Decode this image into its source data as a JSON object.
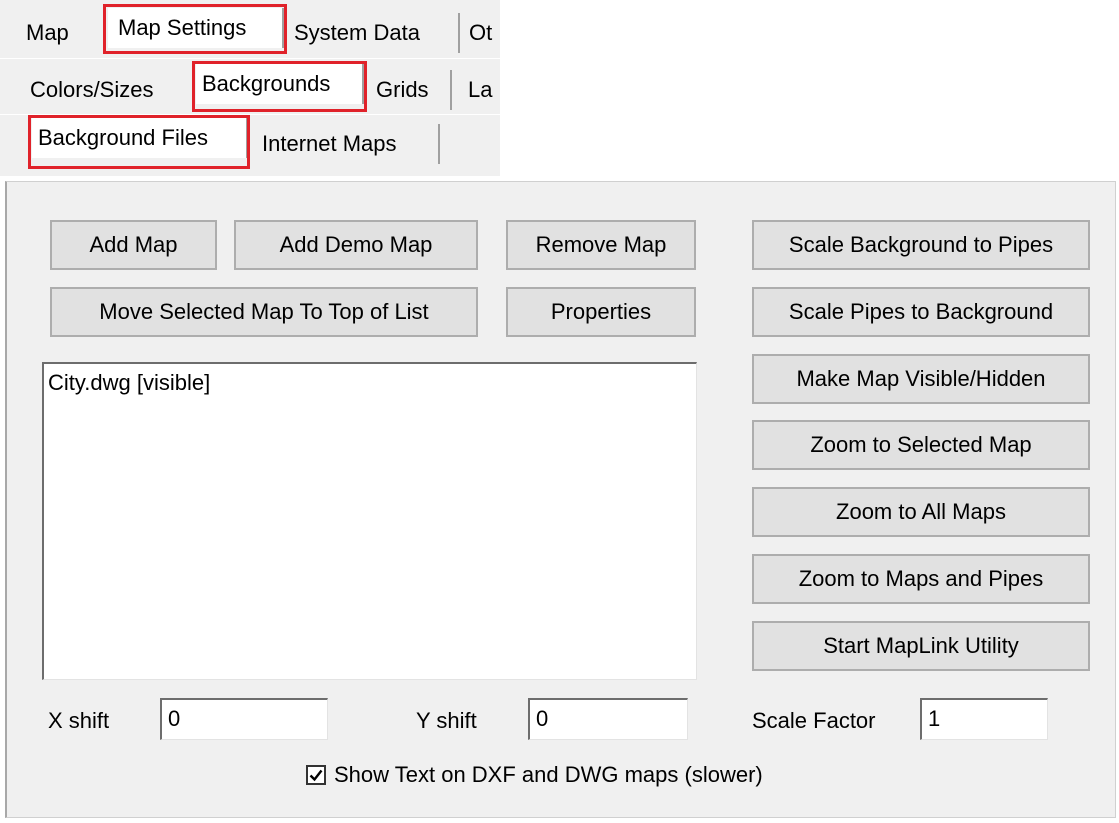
{
  "tabs": {
    "row1": [
      "Map",
      "Map Settings",
      "System Data",
      "Ot"
    ],
    "row2": [
      "Colors/Sizes",
      "Backgrounds",
      "Grids",
      "La"
    ],
    "row3": [
      "Background Files",
      "Internet Maps"
    ]
  },
  "buttons": {
    "add_map": "Add Map",
    "add_demo_map": "Add Demo Map",
    "remove_map": "Remove Map",
    "scale_bg_to_pipes": "Scale Background to Pipes",
    "move_to_top": "Move Selected Map To Top of List",
    "properties": "Properties",
    "scale_pipes_to_bg": "Scale Pipes to Background",
    "make_visible": "Make Map Visible/Hidden",
    "zoom_selected": "Zoom to Selected Map",
    "zoom_all": "Zoom to All Maps",
    "zoom_maps_pipes": "Zoom to Maps and Pipes",
    "start_maplink": "Start MapLink Utility"
  },
  "map_list": [
    "City.dwg [visible]"
  ],
  "fields": {
    "x_shift_label": "X shift",
    "x_shift_value": "0",
    "y_shift_label": "Y shift",
    "y_shift_value": "0",
    "scale_factor_label": "Scale Factor",
    "scale_factor_value": "1"
  },
  "checkbox": {
    "label": "Show Text on DXF and DWG maps (slower)",
    "checked": true
  },
  "colors": {
    "highlight": "#e0222a"
  }
}
